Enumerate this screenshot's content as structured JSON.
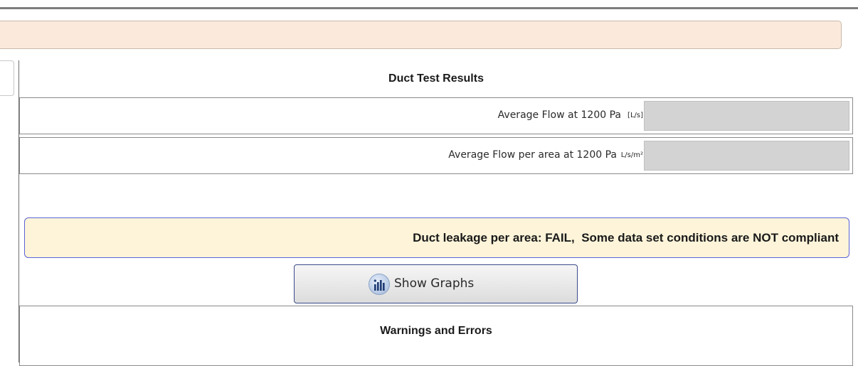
{
  "duct_test_results": {
    "title": "Duct Test Results",
    "rows": [
      {
        "label": "Average Flow at 1200 Pa",
        "unit": "[L/s]",
        "value": ""
      },
      {
        "label": "Average Flow per area at 1200 Pa",
        "unit": "L/s/m²",
        "value": ""
      }
    ]
  },
  "verdict": {
    "text": "Duct leakage per area: FAIL,  Some data set conditions are NOT compliant",
    "background_color": "#fdf4d9",
    "border_color": "#5a63d6"
  },
  "graphs_button": {
    "label": "Show Graphs",
    "icon": "bar-chart-icon"
  },
  "warnings": {
    "title": "Warnings and Errors"
  },
  "colors": {
    "status_strip": "#fbeadc",
    "value_box": "#d3d3d3"
  }
}
